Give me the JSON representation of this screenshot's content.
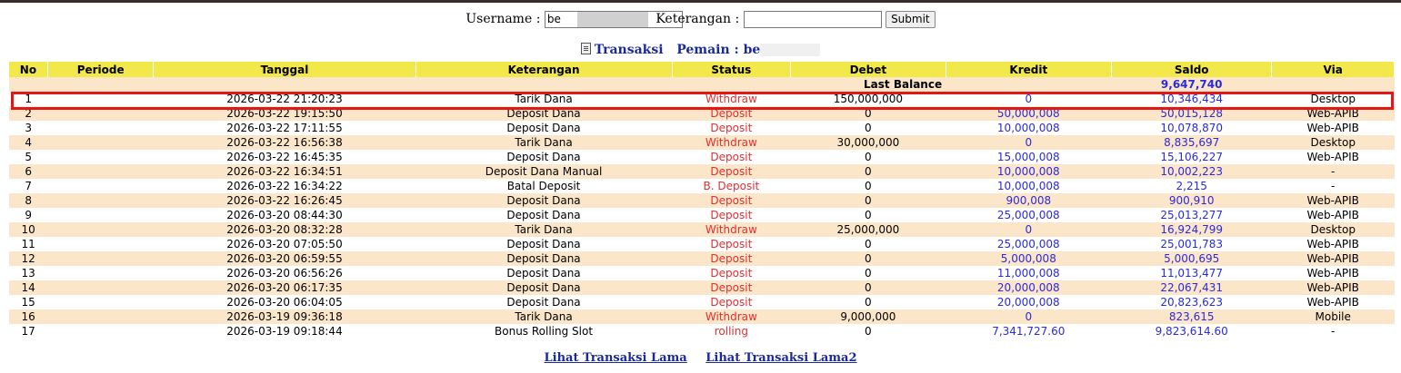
{
  "search": {
    "username_label": "Username :",
    "username_value": "be",
    "keterangan_label": "Keterangan :",
    "keterangan_value": "",
    "submit_label": "Submit"
  },
  "section": {
    "title": "Transaksi",
    "pemain_label": "Pemain : be"
  },
  "table": {
    "headers": [
      "No",
      "Periode",
      "Tanggal",
      "Keterangan",
      "Status",
      "Debet",
      "Kredit",
      "Saldo",
      "Via"
    ],
    "last_balance_label": "Last Balance",
    "last_balance_value": "9,647,740",
    "rows": [
      {
        "no": "1",
        "periode": "",
        "tanggal": "2026-03-22 21:20:23",
        "ket": "Tarik Dana",
        "status": "Withdraw",
        "debet": "150,000,000",
        "kredit": "0",
        "saldo": "10,346,434",
        "via": "Desktop"
      },
      {
        "no": "2",
        "periode": "",
        "tanggal": "2026-03-22 19:15:50",
        "ket": "Deposit Dana",
        "status": "Deposit",
        "debet": "0",
        "kredit": "50,000,008",
        "saldo": "50,015,128",
        "via": "Web-APIB"
      },
      {
        "no": "3",
        "periode": "",
        "tanggal": "2026-03-22 17:11:55",
        "ket": "Deposit Dana",
        "status": "Deposit",
        "debet": "0",
        "kredit": "10,000,008",
        "saldo": "10,078,870",
        "via": "Web-APIB"
      },
      {
        "no": "4",
        "periode": "",
        "tanggal": "2026-03-22 16:56:38",
        "ket": "Tarik Dana",
        "status": "Withdraw",
        "debet": "30,000,000",
        "kredit": "0",
        "saldo": "8,835,697",
        "via": "Desktop"
      },
      {
        "no": "5",
        "periode": "",
        "tanggal": "2026-03-22 16:45:35",
        "ket": "Deposit Dana",
        "status": "Deposit",
        "debet": "0",
        "kredit": "15,000,008",
        "saldo": "15,106,227",
        "via": "Web-APIB"
      },
      {
        "no": "6",
        "periode": "",
        "tanggal": "2026-03-22 16:34:51",
        "ket": "Deposit Dana Manual",
        "status": "Deposit",
        "debet": "0",
        "kredit": "10,000,008",
        "saldo": "10,002,223",
        "via": "-"
      },
      {
        "no": "7",
        "periode": "",
        "tanggal": "2026-03-22 16:34:22",
        "ket": "Batal Deposit",
        "status": "B. Deposit",
        "debet": "0",
        "kredit": "10,000,008",
        "saldo": "2,215",
        "via": "-"
      },
      {
        "no": "8",
        "periode": "",
        "tanggal": "2026-03-22 16:26:45",
        "ket": "Deposit Dana",
        "status": "Deposit",
        "debet": "0",
        "kredit": "900,008",
        "saldo": "900,910",
        "via": "Web-APIB"
      },
      {
        "no": "9",
        "periode": "",
        "tanggal": "2026-03-20 08:44:30",
        "ket": "Deposit Dana",
        "status": "Deposit",
        "debet": "0",
        "kredit": "25,000,008",
        "saldo": "25,013,277",
        "via": "Web-APIB"
      },
      {
        "no": "10",
        "periode": "",
        "tanggal": "2026-03-20 08:32:28",
        "ket": "Tarik Dana",
        "status": "Withdraw",
        "debet": "25,000,000",
        "kredit": "0",
        "saldo": "16,924,799",
        "via": "Desktop"
      },
      {
        "no": "11",
        "periode": "",
        "tanggal": "2026-03-20 07:05:50",
        "ket": "Deposit Dana",
        "status": "Deposit",
        "debet": "0",
        "kredit": "25,000,008",
        "saldo": "25,001,783",
        "via": "Web-APIB"
      },
      {
        "no": "12",
        "periode": "",
        "tanggal": "2026-03-20 06:59:55",
        "ket": "Deposit Dana",
        "status": "Deposit",
        "debet": "0",
        "kredit": "5,000,008",
        "saldo": "5,000,695",
        "via": "Web-APIB"
      },
      {
        "no": "13",
        "periode": "",
        "tanggal": "2026-03-20 06:56:26",
        "ket": "Deposit Dana",
        "status": "Deposit",
        "debet": "0",
        "kredit": "11,000,008",
        "saldo": "11,013,477",
        "via": "Web-APIB"
      },
      {
        "no": "14",
        "periode": "",
        "tanggal": "2026-03-20 06:17:35",
        "ket": "Deposit Dana",
        "status": "Deposit",
        "debet": "0",
        "kredit": "20,000,008",
        "saldo": "22,067,431",
        "via": "Web-APIB"
      },
      {
        "no": "15",
        "periode": "",
        "tanggal": "2026-03-20 06:04:05",
        "ket": "Deposit Dana",
        "status": "Deposit",
        "debet": "0",
        "kredit": "20,000,008",
        "saldo": "20,823,623",
        "via": "Web-APIB"
      },
      {
        "no": "16",
        "periode": "",
        "tanggal": "2026-03-19 09:36:18",
        "ket": "Tarik Dana",
        "status": "Withdraw",
        "debet": "9,000,000",
        "kredit": "0",
        "saldo": "823,615",
        "via": "Mobile"
      },
      {
        "no": "17",
        "periode": "",
        "tanggal": "2026-03-19 09:18:44",
        "ket": "Bonus Rolling Slot",
        "status": "rolling",
        "debet": "0",
        "kredit": "7,341,727.60",
        "saldo": "9,823,614.60",
        "via": "-"
      }
    ]
  },
  "footer": {
    "link1": "Lihat Transaksi Lama",
    "link2": "Lihat Transaksi Lama2"
  },
  "colors": {
    "header_bg": "#f2e84a",
    "stripe_bg": "#fbe6c9",
    "status_red": "#e03030",
    "amount_blue": "#2a2adf",
    "highlight_red": "#e01818"
  }
}
